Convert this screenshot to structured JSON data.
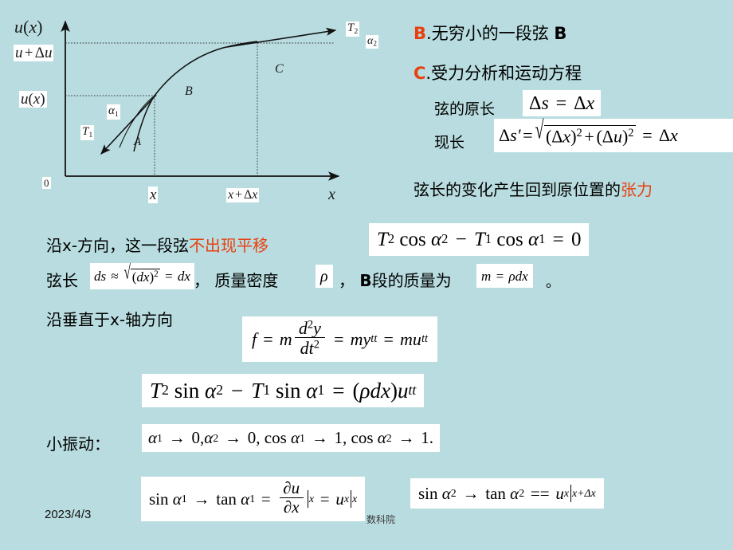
{
  "slide": {
    "background_color": "#b8dcdf",
    "accent_red": "#e8400f",
    "date": "2023/4/3",
    "watermark": "数科院"
  },
  "figure": {
    "name": "string-element-diagram",
    "y_axis_label": "u(x)",
    "y_tick_upper": "u + Δu",
    "y_tick_lower": "u(x)",
    "origin_label": "0",
    "x_tick_left": "x",
    "x_tick_right": "x + Δx",
    "x_axis_label": "x",
    "tension_left": "T₁",
    "tension_right": "T₂",
    "angle_left": "α₁",
    "angle_right": "α₂",
    "point_a": "A",
    "point_b": "B",
    "point_c": "C"
  },
  "section_b": {
    "marker": "B",
    "dot": ".",
    "title": "无穷小的一段弦",
    "suffix": "B"
  },
  "section_c": {
    "marker": "C",
    "dot": ".",
    "title": "受力分析和运动方程",
    "row1_label": "弦的原长",
    "row1_formula": "Δs = Δx",
    "row2_label": "现长",
    "row2_formula": "Δs' = √((Δx)² + (Δu)²) = Δx",
    "note_prefix": "弦长的变化产生回到原位置的",
    "note_highlight": "张力"
  },
  "x_direction": {
    "text_prefix": "沿x-方向，这一段弦",
    "text_highlight": "不出现平移",
    "equation": "T₂ cos α₂ − T₁ cos α₁ = 0"
  },
  "mass_row": {
    "label1": "弦长",
    "formula1": "ds ≈ √((dx)²) = dx",
    "comma1": "，",
    "label2": "质量密度",
    "formula2": "ρ",
    "comma2": "，",
    "label3_bold": "B",
    "label3": "段的质量为",
    "formula3": "m = ρdx",
    "period": "。"
  },
  "perp_row": {
    "label": "沿垂直于x-轴方向",
    "formula": "f = m d²y/dt² = myₜₜ = muₜₜ"
  },
  "main_equation": {
    "formula": "T₂ sin α₂ − T₁ sin α₁ = (ρdx)uₜₜ"
  },
  "small_vibration": {
    "label": "小振动：",
    "formula": "α₁ → 0, α₂ → 0, cos α₁ → 1, cos α₂ → 1."
  },
  "limit_formulas": {
    "left": "sin α₁ → tan α₁ = ∂u/∂x |ₓ = uₓ|ₓ",
    "right": "sin α₂ → tan α₂ == uₓ|ₓ₊Δₓ"
  },
  "symbols": {
    "delta": "Δ",
    "alpha": "α",
    "rho": "ρ",
    "partial": "∂",
    "arrow": "→",
    "minus": "−",
    "approx": "≈",
    "sqrt": "√"
  }
}
